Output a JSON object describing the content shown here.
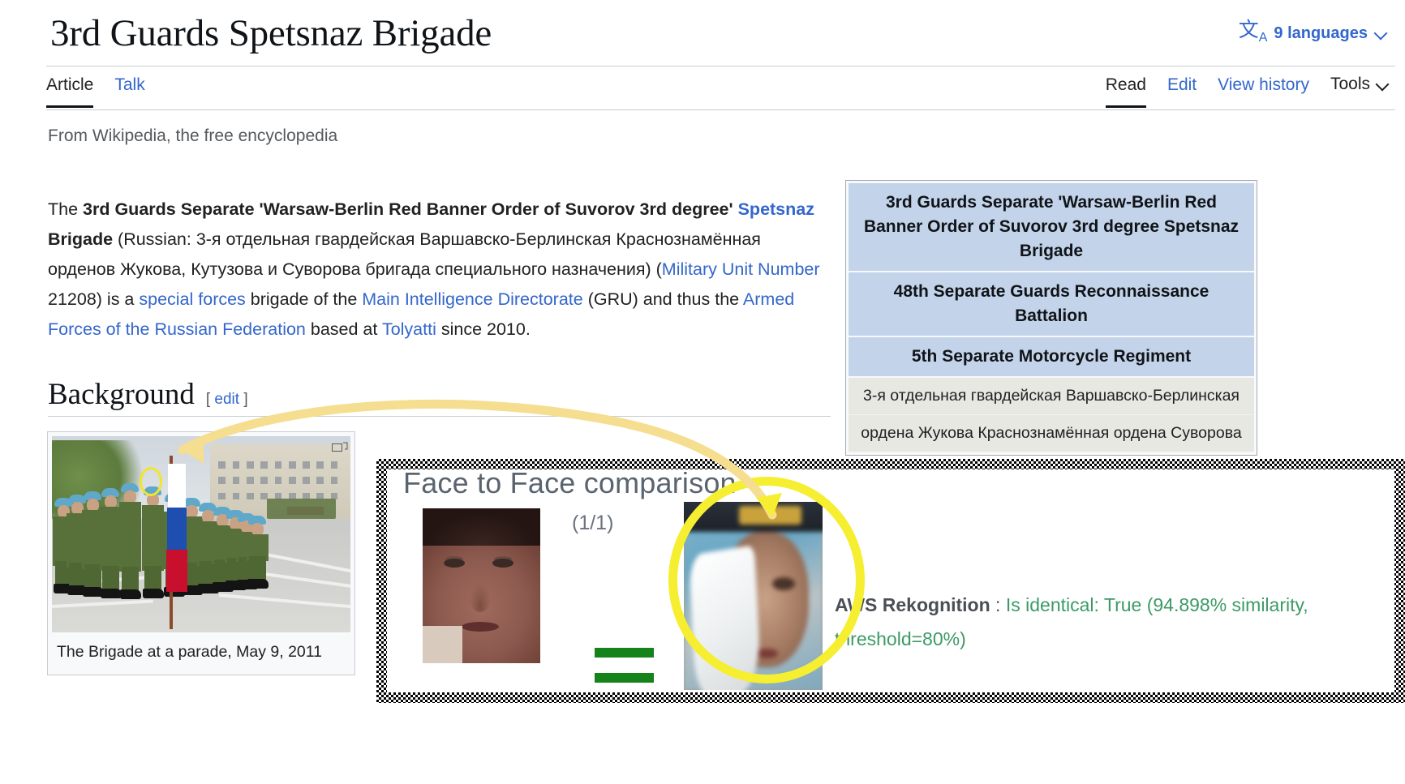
{
  "header": {
    "title": "3rd Guards Spetsnaz Brigade",
    "language_icon": "language-icon",
    "languages_label": "9 languages",
    "chevron_icon": "chevron-down-icon"
  },
  "tabs": {
    "left": [
      {
        "label": "Article",
        "selected": true
      },
      {
        "label": "Talk",
        "selected": false
      }
    ],
    "right": [
      {
        "label": "Read",
        "selected": true
      },
      {
        "label": "Edit",
        "selected": false
      },
      {
        "label": "View history",
        "selected": false
      }
    ],
    "tools_label": "Tools",
    "tools_chevron_icon": "chevron-down-icon"
  },
  "siteline": "From Wikipedia, the free encyclopedia",
  "lead": {
    "t1": "The ",
    "b1": "3rd Guards Separate 'Warsaw-Berlin Red Banner Order of Suvorov 3rd degree' ",
    "link_spetsnaz": "Spetsnaz",
    "b2": " Brigade",
    "t2": " (Russian: 3-я отдельная гвардейская Варшавско-Берлинская Краснознамённая орденов Жукова, Кутузова и Суворова бригада специального назначения) (",
    "link_munit": "Military Unit Number",
    "t3": " 21208) is a ",
    "link_sf": "special forces",
    "t4": " brigade of the ",
    "link_gru": "Main Intelligence Directorate",
    "t5": " (GRU) and thus the ",
    "link_af": "Armed Forces of the Russian Federation",
    "t6": " based at ",
    "link_tolyatti": "Tolyatti",
    "t7": " since 2010."
  },
  "section": {
    "heading": "Background",
    "edit_open": "[ ",
    "edit_label": "edit",
    "edit_close": " ]"
  },
  "figure": {
    "caption": "The Brigade at a parade, May 9, 2011",
    "expand_icon": "expand-thumbnail-icon",
    "annotation_icon": "yellow-circle-highlight"
  },
  "infobox": {
    "rows": [
      "3rd Guards Separate 'Warsaw-Berlin Red Banner Order of Suvorov 3rd degree Spetsnaz Brigade",
      "48th Separate Guards Reconnaissance Battalion",
      "5th Separate Motorcycle Regiment"
    ],
    "subrows": [
      "3-я отдельная гвардейская Варшавско-Берлинская",
      "ордена Жукова Краснознамённая ордена Суворова"
    ],
    "header_bg": "#c3d3ea"
  },
  "overlay": {
    "title": "Face to Face comparison",
    "counter": "(1/1)",
    "equals_icon": "equals-sign-icon",
    "equals_color": "#15831a",
    "highlight_color": "#f6ee30",
    "face_a_name": "reference-face-photo",
    "face_b_name": "candidate-face-photo",
    "result": {
      "label": "AWS Rekognition",
      "separator": " : ",
      "text": "Is identical: True (94.898% similarity, threshold=80%)",
      "color": "#3c9a66"
    }
  },
  "colors": {
    "link": "#3366cc",
    "text": "#202122",
    "rule": "#c8ccd1",
    "annotation_yellow": "#f6ee30",
    "arrow_yellow": "#f5de8f"
  }
}
